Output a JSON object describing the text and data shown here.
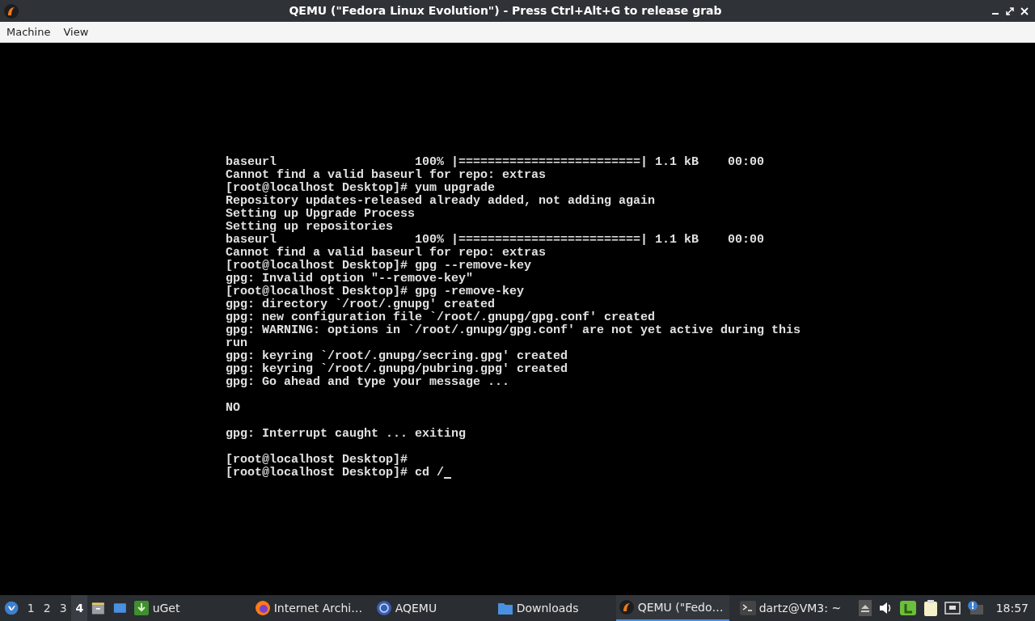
{
  "window": {
    "title": "QEMU (\"Fedora Linux Evolution\") - Press Ctrl+Alt+G to release grab"
  },
  "menu": [
    "Machine",
    "View"
  ],
  "terminal": {
    "cursor": true,
    "blocks": [
      [
        "baseurl                   100% |=========================| 1.1 kB    00:00",
        "Cannot find a valid baseurl for repo: extras",
        "[root@localhost Desktop]# yum upgrade",
        "Repository updates-released already added, not adding again",
        "Setting up Upgrade Process",
        "Setting up repositories",
        "baseurl                   100% |=========================| 1.1 kB    00:00",
        "Cannot find a valid baseurl for repo: extras",
        "[root@localhost Desktop]# gpg --remove-key",
        "gpg: Invalid option \"--remove-key\"",
        "[root@localhost Desktop]# gpg -remove-key",
        "gpg: directory `/root/.gnupg' created",
        "gpg: new configuration file `/root/.gnupg/gpg.conf' created",
        "gpg: WARNING: options in `/root/.gnupg/gpg.conf' are not yet active during this",
        "run",
        "gpg: keyring `/root/.gnupg/secring.gpg' created",
        "gpg: keyring `/root/.gnupg/pubring.gpg' created",
        "gpg: Go ahead and type your message ..."
      ],
      [
        "NO"
      ],
      [
        "gpg: Interrupt caught ... exiting"
      ],
      [
        "[root@localhost Desktop]#",
        "[root@localhost Desktop]# cd /"
      ]
    ]
  },
  "taskbar": {
    "workspaces": [
      {
        "label": "1",
        "selected": false
      },
      {
        "label": "2",
        "selected": false
      },
      {
        "label": "3",
        "selected": false
      },
      {
        "label": "4",
        "selected": true
      }
    ],
    "tasks": [
      {
        "kind": "uget",
        "label": "uGet",
        "selected": false
      },
      {
        "kind": "firefox",
        "label": "Internet Archi…",
        "selected": false
      },
      {
        "kind": "aqemu",
        "label": "AQEMU",
        "selected": false
      },
      {
        "kind": "folder",
        "label": "Downloads",
        "selected": false
      },
      {
        "kind": "qemu",
        "label": "QEMU (\"Fedo…",
        "selected": true
      },
      {
        "kind": "terminal",
        "label": "dartz@VM3: ~",
        "selected": false
      }
    ],
    "clock": "18:57"
  }
}
